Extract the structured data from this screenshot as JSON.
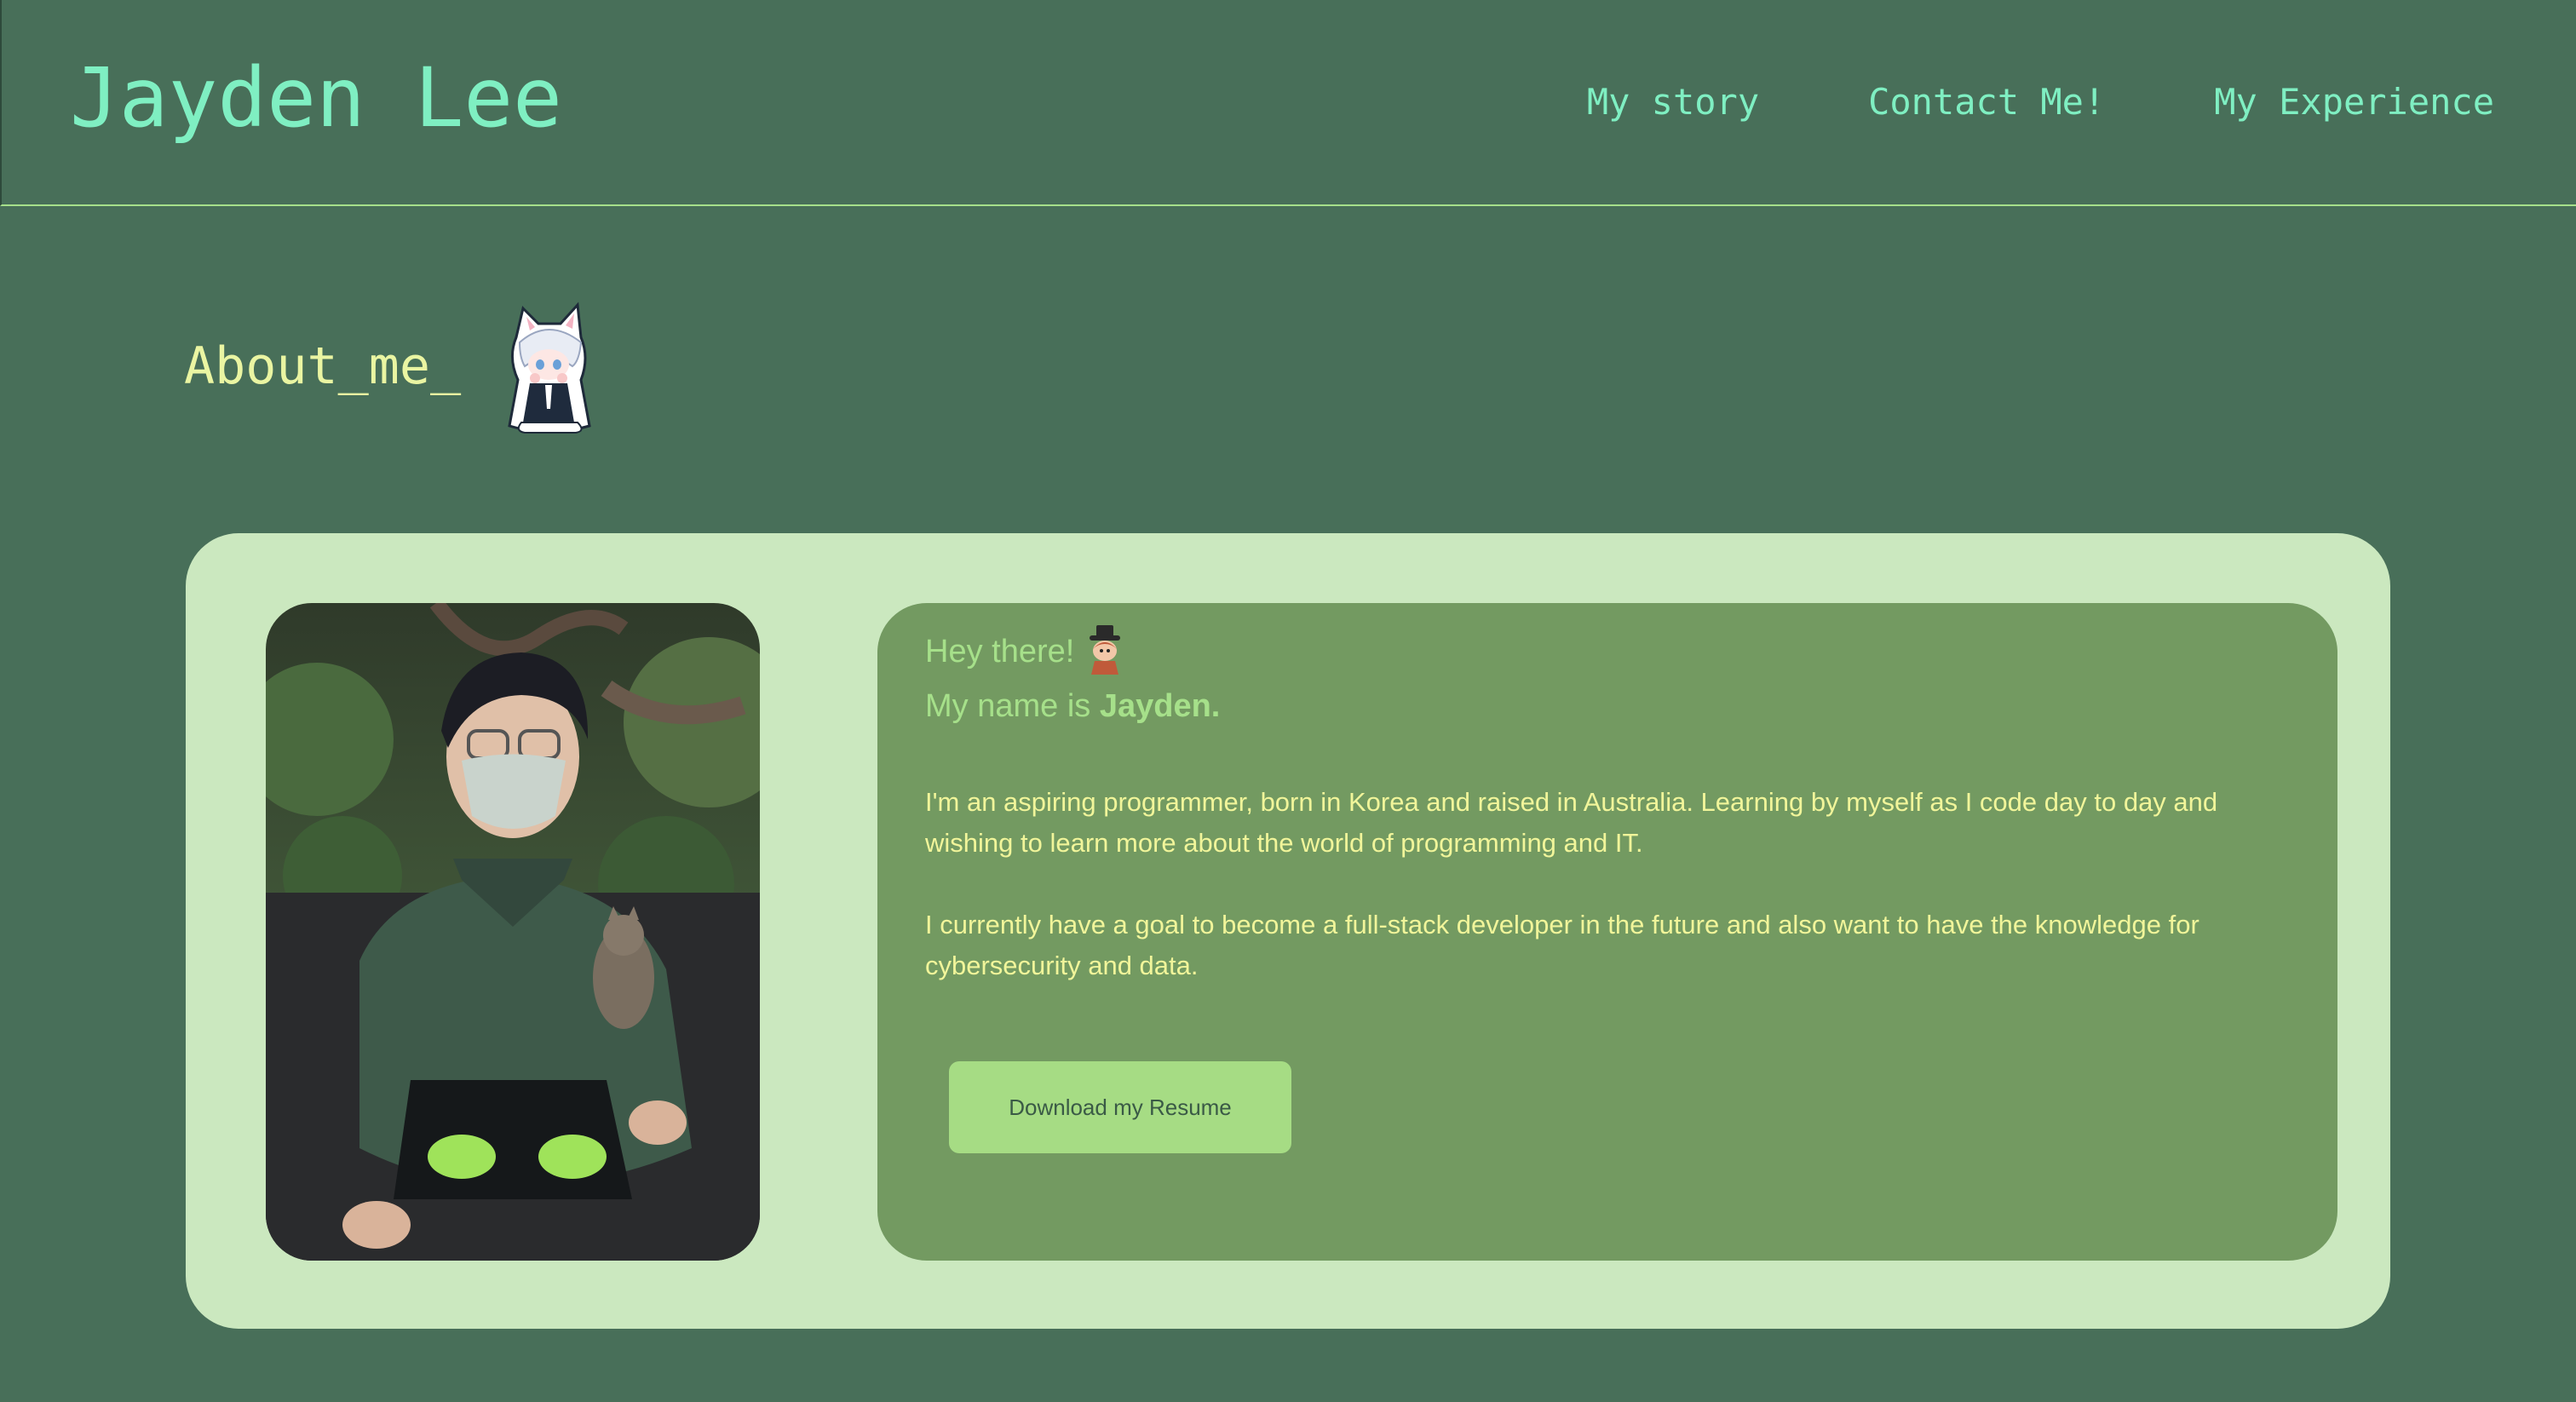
{
  "header": {
    "title": "Jayden Lee",
    "nav": [
      {
        "label": "My story"
      },
      {
        "label": "Contact Me!"
      },
      {
        "label": "My Experience"
      }
    ]
  },
  "about": {
    "heading": "About_me_",
    "greeting_line1": "Hey there!",
    "greeting_prefix": "My name is ",
    "greeting_name": "Jayden.",
    "paragraph1": "I'm an aspiring programmer, born in Korea and raised in Australia. Learning by myself as I code day to day and wishing to learn more about the world of programming and IT.",
    "paragraph2": "I currently have a goal to become a full-stack developer in the future and also want to have the knowledge for cybersecurity and data.",
    "resume_button": "Download my Resume"
  },
  "colors": {
    "page_background": "#486f59",
    "accent_text": "#7fefc2",
    "heading_yellow": "#eaf5a2",
    "card_background": "#cbe8bf",
    "panel_background": "#739a61",
    "button_background": "#a6dc84"
  },
  "icons": {
    "mascot": "anime-cat-girl-sticker",
    "greeting_emoji": "hat-character-icon",
    "photo": "profile-photo-with-cat"
  }
}
